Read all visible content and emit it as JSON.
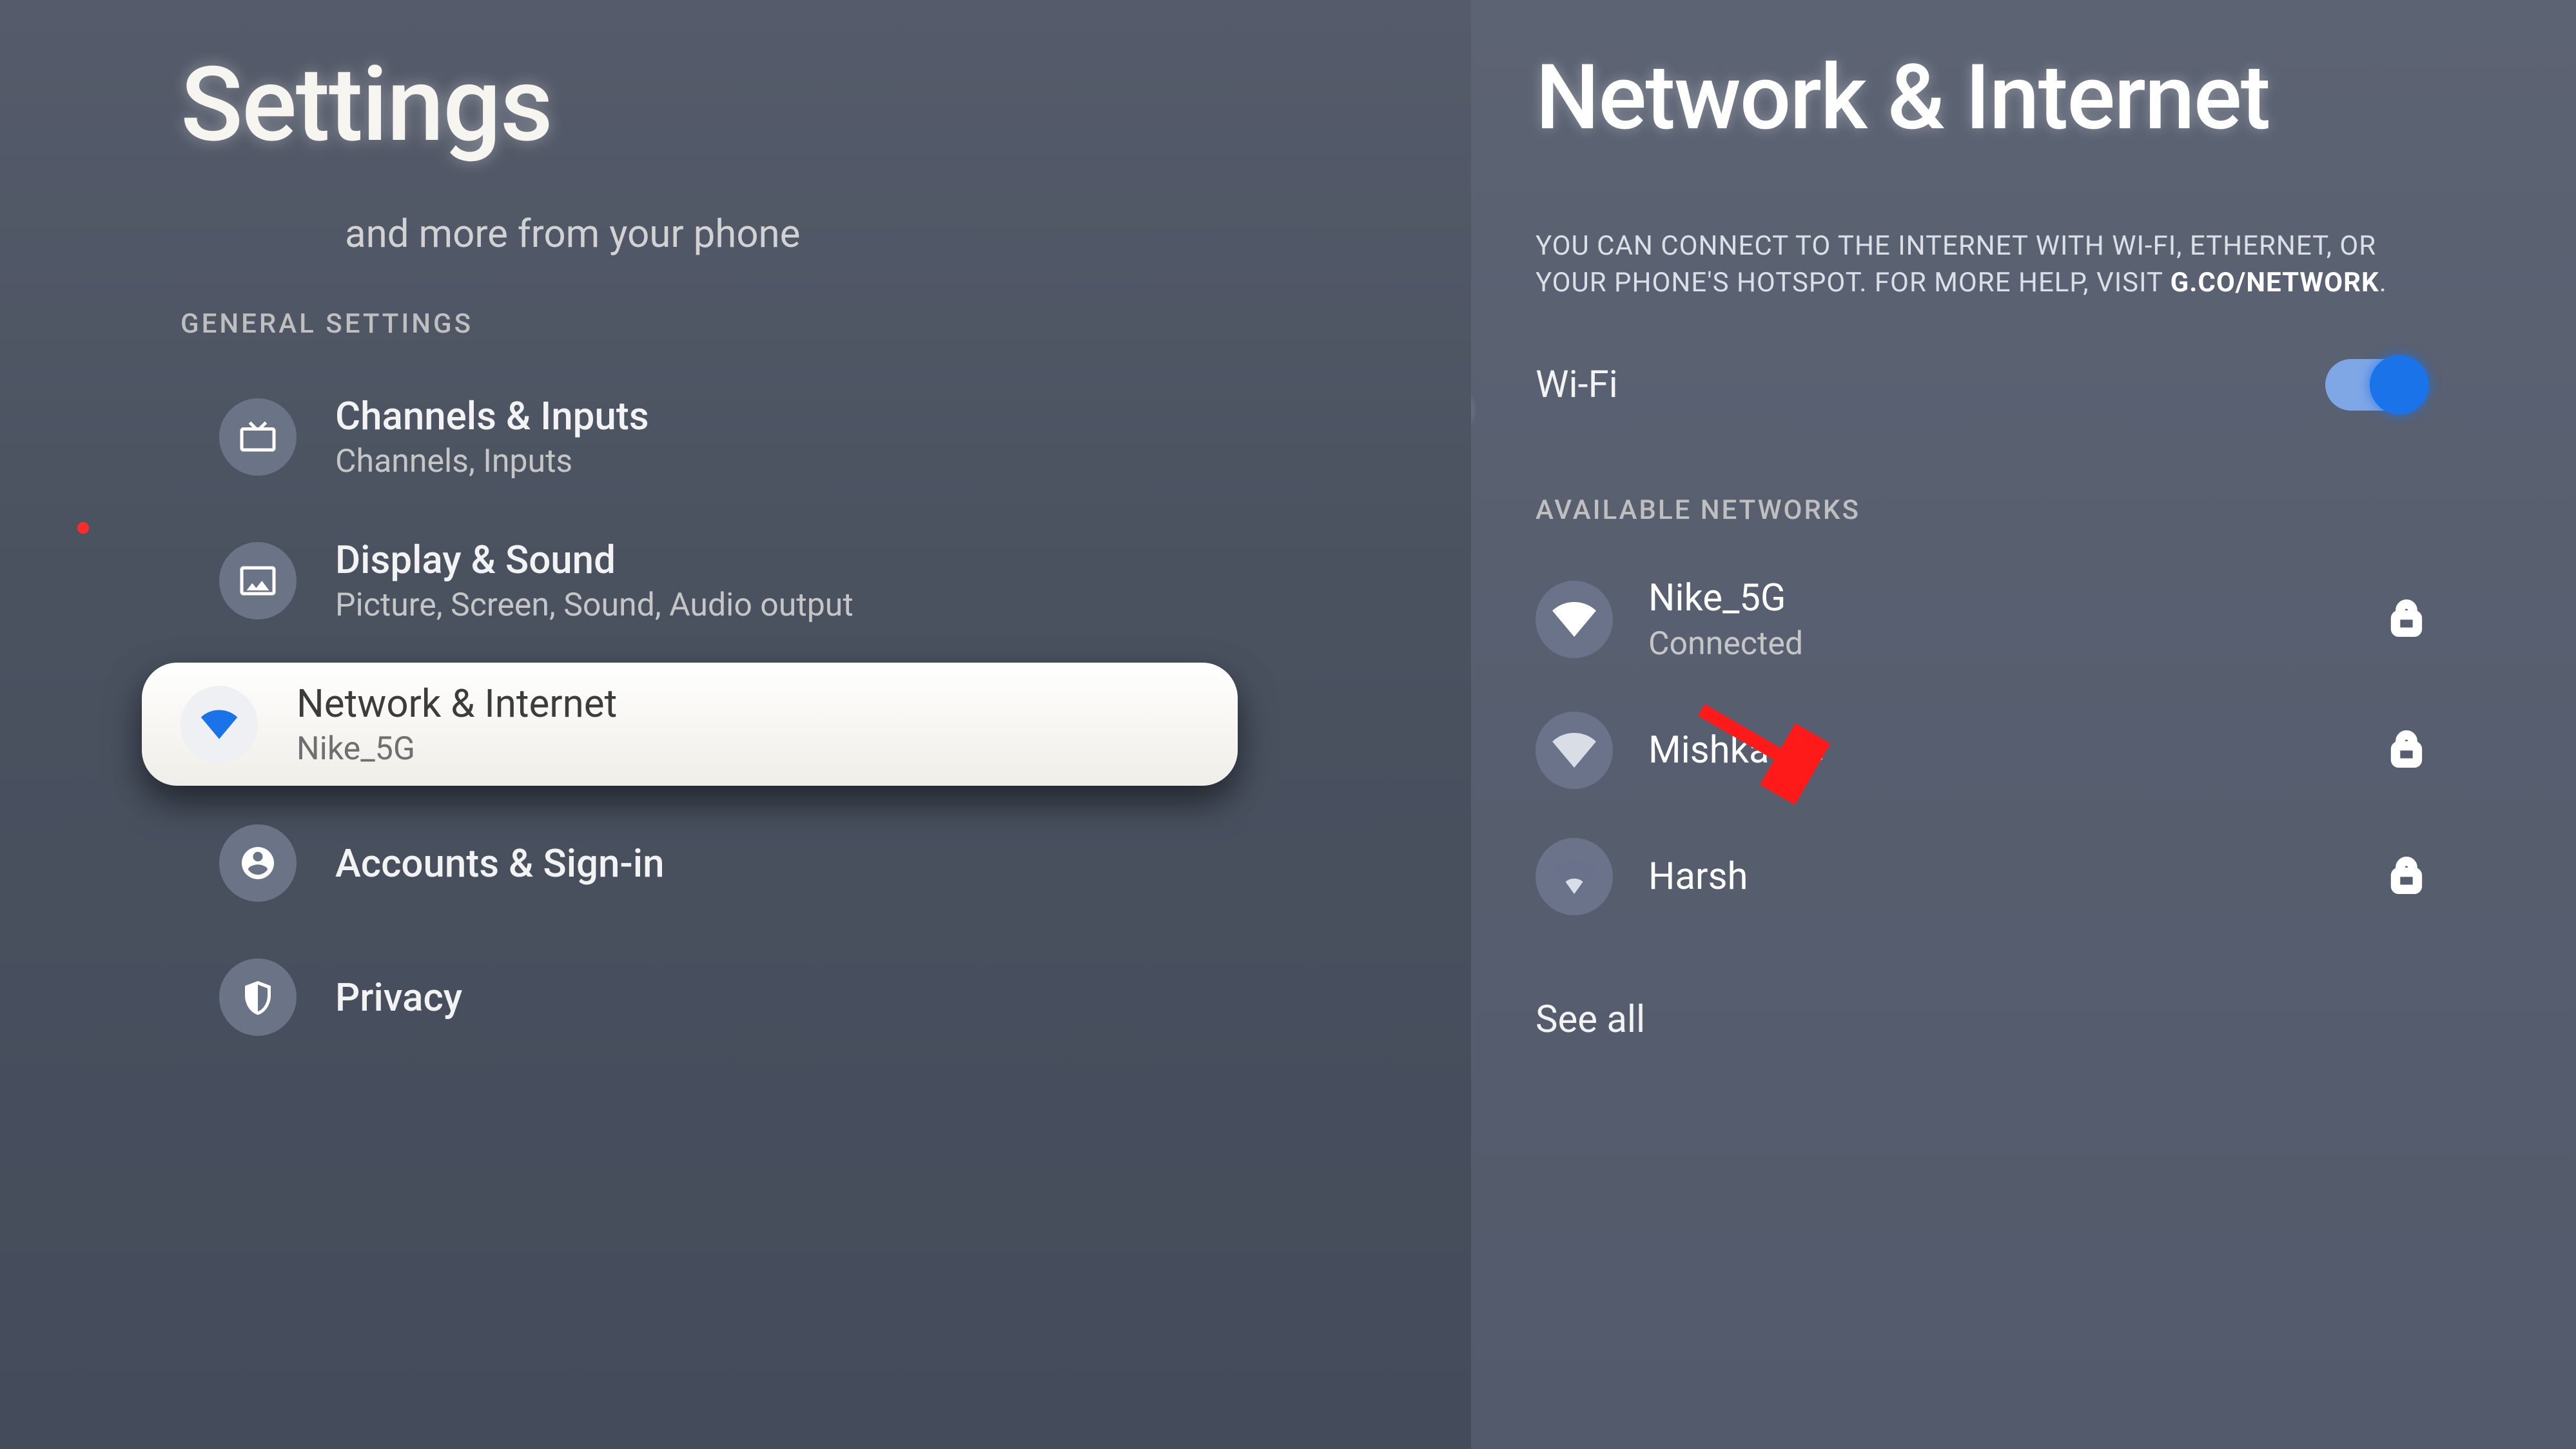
{
  "left": {
    "title": "Settings",
    "truncated_tail": "and more from your phone",
    "section_label": "GENERAL SETTINGS",
    "items": [
      {
        "icon": "tv",
        "title": "Channels & Inputs",
        "sub": "Channels, Inputs"
      },
      {
        "icon": "image",
        "title": "Display & Sound",
        "sub": "Picture, Screen, Sound, Audio output"
      },
      {
        "icon": "wifi",
        "title": "Network & Internet",
        "sub": "Nike_5G",
        "selected": true
      },
      {
        "icon": "account",
        "title": "Accounts & Sign-in",
        "sub": ""
      },
      {
        "icon": "shield",
        "title": "Privacy",
        "sub": ""
      }
    ]
  },
  "right": {
    "title": "Network & Internet",
    "helper_pre": "YOU CAN CONNECT TO THE INTERNET WITH WI-FI, ETHERNET, OR YOUR PHONE'S HOTSPOT. FOR MORE HELP, VISIT ",
    "helper_bold": "G.CO/NETWORK",
    "helper_post": ".",
    "wifi_label": "Wi-Fi",
    "wifi_on": true,
    "avail_label": "AVAILABLE NETWORKS",
    "networks": [
      {
        "ssid": "Nike_5G",
        "state": "Connected",
        "connected": true,
        "locked": true,
        "strength": "full"
      },
      {
        "ssid": "Mishka 4G",
        "state": "",
        "connected": false,
        "locked": true,
        "strength": "full"
      },
      {
        "ssid": "Harsh",
        "state": "",
        "connected": false,
        "locked": true,
        "strength": "weak"
      }
    ],
    "see_all": "See all"
  }
}
